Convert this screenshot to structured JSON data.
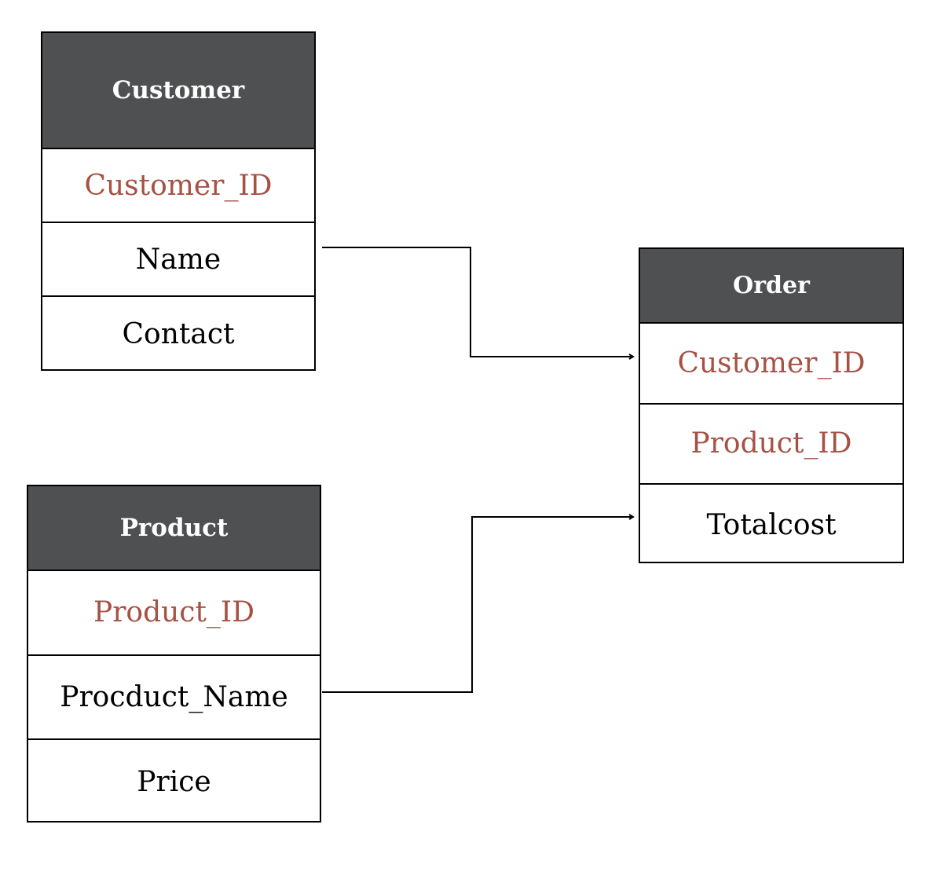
{
  "colors": {
    "header_bg": "#4f5052",
    "header_text": "#ffffff",
    "key_text": "#a65144",
    "field_text": "#000000",
    "border": "#000000"
  },
  "entities": {
    "customer": {
      "title": "Customer",
      "fields": [
        {
          "name": "Customer_ID",
          "key": true
        },
        {
          "name": "Name",
          "key": false
        },
        {
          "name": "Contact",
          "key": false
        }
      ]
    },
    "order": {
      "title": "Order",
      "fields": [
        {
          "name": "Customer_ID",
          "key": true
        },
        {
          "name": "Product_ID",
          "key": true
        },
        {
          "name": "Totalcost",
          "key": false
        }
      ]
    },
    "product": {
      "title": "Product",
      "fields": [
        {
          "name": "Product_ID",
          "key": true
        },
        {
          "name": "Procduct_Name",
          "key": false
        },
        {
          "name": "Price",
          "key": false
        }
      ]
    }
  },
  "relationships": [
    {
      "from": "Customer.Name",
      "to": "Order.Customer_ID",
      "arrow": "end"
    },
    {
      "from": "Product.Procduct_Name",
      "to": "Order.Totalcost",
      "arrow": "end"
    }
  ]
}
